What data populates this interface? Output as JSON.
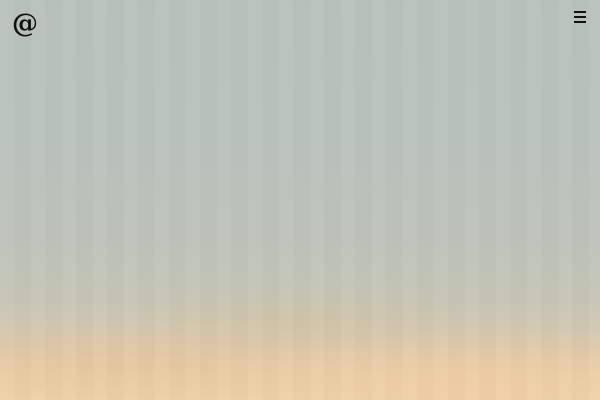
{
  "header": {
    "logo_text": "@",
    "menu_icon": "hamburger-menu-icon"
  },
  "hero": {
    "background": {
      "top_color": "#b9c3bb",
      "bottom_color": "#f0d3ab"
    }
  }
}
